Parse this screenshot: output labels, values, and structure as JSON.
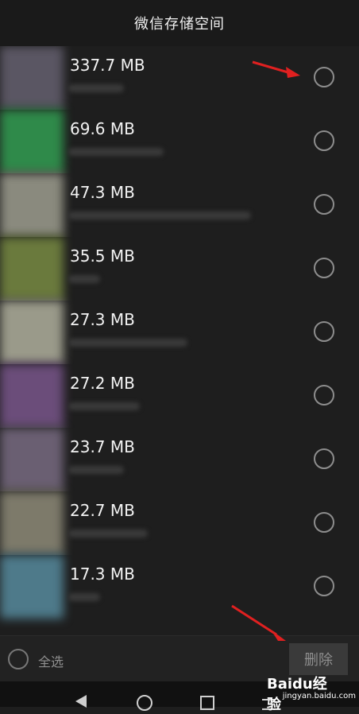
{
  "header": {
    "title": "微信存储空间"
  },
  "items": [
    {
      "size": "337.7 MB",
      "thumb": "#5a5663",
      "line_width": 70
    },
    {
      "size": "69.6 MB",
      "thumb": "#2f8a4a",
      "line_width": 120
    },
    {
      "size": "47.3 MB",
      "thumb": "#8a8a7e",
      "line_width": 230
    },
    {
      "size": "35.5 MB",
      "thumb": "#6a7a3d",
      "line_width": 40
    },
    {
      "size": "27.3 MB",
      "thumb": "#9a9a8a",
      "line_width": 150
    },
    {
      "size": "27.2 MB",
      "thumb": "#6b4d7a",
      "line_width": 90
    },
    {
      "size": "23.7 MB",
      "thumb": "#6a5f72",
      "line_width": 70
    },
    {
      "size": "22.7 MB",
      "thumb": "#7d7a6a",
      "line_width": 100
    },
    {
      "size": "17.3 MB",
      "thumb": "#4e7a8a",
      "line_width": 40
    }
  ],
  "footer": {
    "select_all": "全选",
    "delete": "删除"
  },
  "watermark": {
    "brand": "Baidu经验",
    "url": "jingyan.baidu.com"
  },
  "annotation_color": "#e02020"
}
